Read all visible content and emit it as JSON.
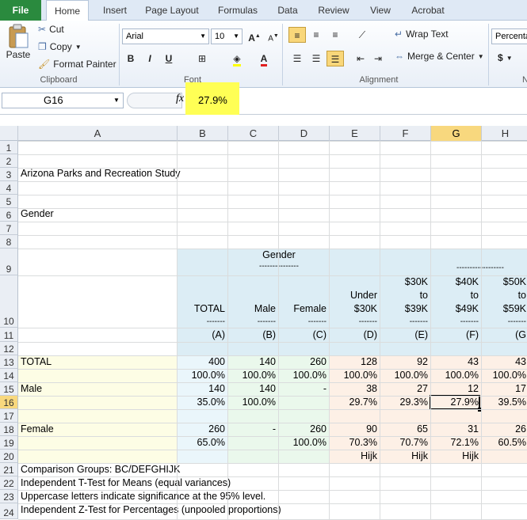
{
  "ribbon": {
    "tabs": [
      "File",
      "Home",
      "Insert",
      "Page Layout",
      "Formulas",
      "Data",
      "Review",
      "View",
      "Acrobat"
    ],
    "clipboard": {
      "paste": "Paste",
      "cut": "Cut",
      "copy": "Copy",
      "format_painter": "Format Painter",
      "label": "Clipboard"
    },
    "font": {
      "name": "Arial",
      "size": "10",
      "label": "Font",
      "bold": "B",
      "italic": "I",
      "underline": "U"
    },
    "alignment": {
      "wrap_text": "Wrap Text",
      "merge_center": "Merge & Center",
      "label": "Alignment"
    },
    "number": {
      "format": "Percenta",
      "currency": "$",
      "label": "N"
    }
  },
  "formula_bar": {
    "name_box": "G16",
    "fx": "fx",
    "value": "27.9%"
  },
  "columns": [
    "A",
    "B",
    "C",
    "D",
    "E",
    "F",
    "G",
    "H"
  ],
  "rows": [
    "1",
    "2",
    "3",
    "4",
    "5",
    "6",
    "7",
    "8",
    "9",
    "10",
    "11",
    "12",
    "13",
    "14",
    "15",
    "16",
    "17",
    "18",
    "19",
    "20",
    "21",
    "22",
    "23",
    "24"
  ],
  "sheet": {
    "title": "Arizona Parks and Recreation Study",
    "subtitle": "Gender",
    "header": {
      "gender": "Gender",
      "gender_dashes": "---------------",
      "income_dashes": "------------------",
      "cols": [
        {
          "l1": "",
          "l2": "",
          "l3": "TOTAL",
          "dash": "-------",
          "code": "(A)"
        },
        {
          "l1": "",
          "l2": "",
          "l3": "Male",
          "dash": "-------",
          "code": "(B)"
        },
        {
          "l1": "",
          "l2": "",
          "l3": "Female",
          "dash": "-------",
          "code": "(C)"
        },
        {
          "l1": "",
          "l2": "Under",
          "l3": "$30K",
          "dash": "-------",
          "code": "(D)"
        },
        {
          "l1": "$30K",
          "l2": "to",
          "l3": "$39K",
          "dash": "-------",
          "code": "(E)"
        },
        {
          "l1": "$40K",
          "l2": "to",
          "l3": "$49K",
          "dash": "-------",
          "code": "(F)"
        },
        {
          "l1": "$50K",
          "l2": "to",
          "l3": "$59K",
          "dash": "-------",
          "code": "(G"
        }
      ]
    },
    "data": {
      "total_label": "TOTAL",
      "total": [
        "400",
        "140",
        "260",
        "128",
        "92",
        "43",
        "43"
      ],
      "total_pct": [
        "100.0%",
        "100.0%",
        "100.0%",
        "100.0%",
        "100.0%",
        "100.0%",
        "100.0%"
      ],
      "male_label": "Male",
      "male": [
        "140",
        "140",
        "-",
        "38",
        "27",
        "12",
        "17"
      ],
      "male_pct": [
        "35.0%",
        "100.0%",
        "",
        "29.7%",
        "29.3%",
        "27.9%",
        "39.5%"
      ],
      "female_label": "Female",
      "female": [
        "260",
        "-",
        "260",
        "90",
        "65",
        "31",
        "26"
      ],
      "female_pct": [
        "65.0%",
        "",
        "100.0%",
        "70.3%",
        "70.7%",
        "72.1%",
        "60.5%"
      ],
      "sig": [
        "",
        "",
        "",
        "Hijk",
        "Hijk",
        "Hijk",
        ""
      ]
    },
    "notes": [
      "Comparison Groups: BC/DEFGHIJK",
      "Independent T-Test for Means (equal variances)",
      "Uppercase letters indicate significance at the 95% level.",
      "Independent Z-Test for Percentages (unpooled proportions)"
    ]
  },
  "colors": {
    "highlight": "#ffff55",
    "header_blue": "#dcedf5",
    "total_yellow": "#fdfde5",
    "selection": "#f8d87e"
  }
}
